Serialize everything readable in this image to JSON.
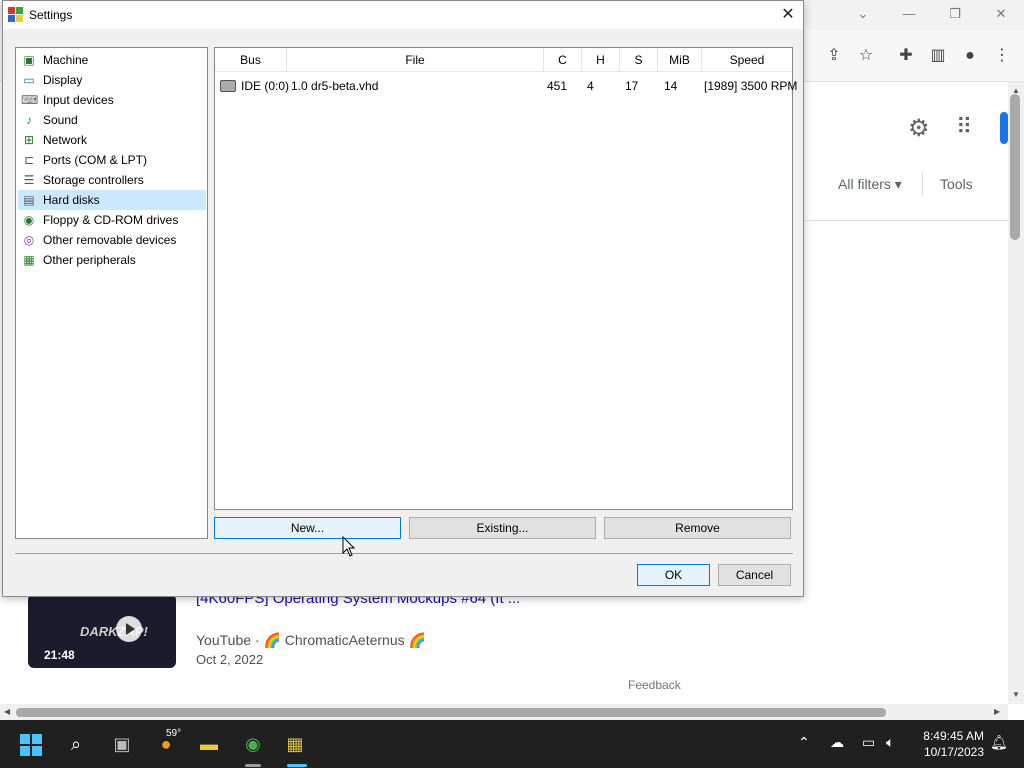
{
  "dialog": {
    "title": "Settings",
    "close_label": "✕",
    "tree_items": [
      {
        "label": "Machine",
        "icon": "machine-icon"
      },
      {
        "label": "Display",
        "icon": "display-icon"
      },
      {
        "label": "Input devices",
        "icon": "input-devices-icon"
      },
      {
        "label": "Sound",
        "icon": "sound-icon"
      },
      {
        "label": "Network",
        "icon": "network-icon"
      },
      {
        "label": "Ports (COM & LPT)",
        "icon": "ports-icon"
      },
      {
        "label": "Storage controllers",
        "icon": "storage-icon"
      },
      {
        "label": "Hard disks",
        "icon": "hard-disk-icon",
        "selected": true
      },
      {
        "label": "Floppy & CD-ROM drives",
        "icon": "floppy-cdrom-icon"
      },
      {
        "label": "Other removable devices",
        "icon": "removable-icon"
      },
      {
        "label": "Other peripherals",
        "icon": "peripherals-icon"
      }
    ],
    "columns": [
      "Bus",
      "File",
      "C",
      "H",
      "S",
      "MiB",
      "Speed"
    ],
    "rows": [
      {
        "bus": "IDE (0:0)",
        "file": "1.0 dr5-beta.vhd",
        "c": "451",
        "h": "4",
        "s": "17",
        "mib": "14",
        "speed": "[1989] 3500 RPM"
      }
    ],
    "buttons": {
      "new": "New...",
      "existing": "Existing...",
      "remove": "Remove",
      "ok": "OK",
      "cancel": "Cancel"
    }
  },
  "browser": {
    "filters": "All filters",
    "tools": "Tools",
    "result": {
      "title": "[4K60FPS] Operating System Mockups #64 (It ...",
      "source": "YouTube · 🌈 ChromaticAeternus 🌈",
      "date": "Oct 2, 2022",
      "duration": "21:48",
      "thumb_text": "DARKZAP!"
    },
    "feedback": "Feedback"
  },
  "taskbar": {
    "weather": "59°",
    "time": "8:49:45 AM",
    "date": "10/17/2023"
  },
  "colors": {
    "selection": "#cce8ff",
    "accent": "#0078d7",
    "taskbar": "#202020",
    "link": "#1a0dab"
  }
}
